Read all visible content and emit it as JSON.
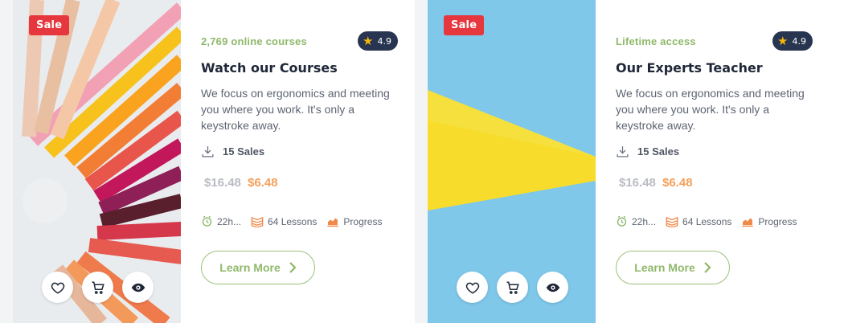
{
  "cards": [
    {
      "sale_badge": "Sale",
      "count_label": "2,769 online courses",
      "rating": "4.9",
      "title": "Watch our Courses",
      "description": "We focus on ergonomics and meeting you where you work. It's only a keystroke away.",
      "sales": "15 Sales",
      "old_price": "$16.48",
      "new_price": "$6.48",
      "duration": "22h...",
      "lessons": "64 Lessons",
      "progress": "Progress",
      "button": "Learn More"
    },
    {
      "sale_badge": "Sale",
      "count_label": "Lifetime access",
      "rating": "4.9",
      "title": "Our Experts Teacher",
      "description": "We focus on ergonomics and meeting you where you work. It's only a keystroke away.",
      "sales": "15 Sales",
      "old_price": "$16.48",
      "new_price": "$6.48",
      "duration": "22h...",
      "lessons": "64 Lessons",
      "progress": "Progress",
      "button": "Learn More"
    }
  ],
  "colors": {
    "accent_green": "#8fb86a",
    "sale_red": "#e5373d",
    "rating_bg": "#283550",
    "price_new": "#f5a05b",
    "price_old": "#b9bcc2"
  },
  "icons": [
    "heart-icon",
    "cart-icon",
    "eye-icon",
    "star-icon",
    "download-icon",
    "clock-icon",
    "book-icon",
    "chart-icon",
    "chevron-right-icon"
  ]
}
